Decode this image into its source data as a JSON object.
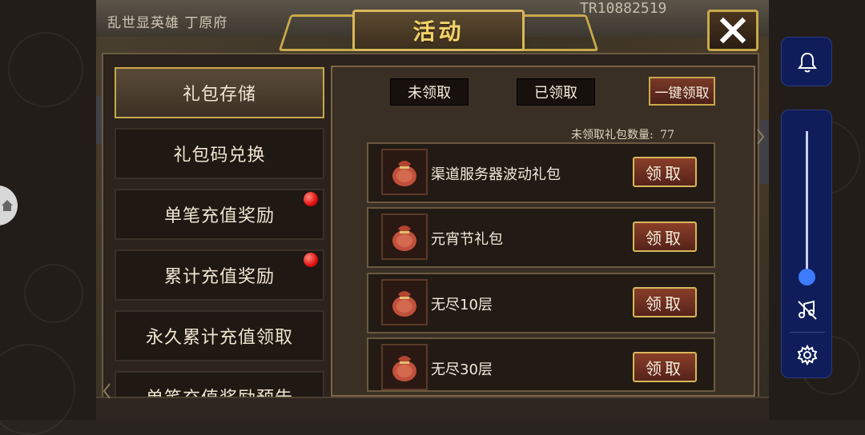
{
  "game": {
    "title": "乱世显英雄 丁原府",
    "player_id": "TR10882519"
  },
  "dialog": {
    "title": "活动"
  },
  "sidebar": {
    "tabs": [
      {
        "label": "礼包存储",
        "active": true,
        "badge": false
      },
      {
        "label": "礼包码兑换",
        "active": false,
        "badge": false
      },
      {
        "label": "单笔充值奖励",
        "active": false,
        "badge": true
      },
      {
        "label": "累计充值奖励",
        "active": false,
        "badge": true
      },
      {
        "label": "永久累计充值领取",
        "active": false,
        "badge": false
      },
      {
        "label": "单笔充值奖励预告",
        "active": false,
        "badge": false
      }
    ]
  },
  "filters": {
    "unclaimed": "未领取",
    "claimed": "已领取",
    "claim_all": "一键领取"
  },
  "count": {
    "label": "未领取礼包数量:",
    "value": "77"
  },
  "gifts": [
    {
      "name": "渠道服务器波动礼包",
      "button": "领取",
      "icon": "gift-bag-icon"
    },
    {
      "name": "元宵节礼包",
      "button": "领取",
      "icon": "gift-bag-icon"
    },
    {
      "name": "无尽10层",
      "button": "领取",
      "icon": "gift-bag-icon"
    },
    {
      "name": "无尽30层",
      "button": "领取",
      "icon": "gift-bag-icon"
    }
  ],
  "colors": {
    "accent_gold": "#c9a84a",
    "badge_red": "#e01010",
    "overlay_blue": "#0f1e5a",
    "slider_blue": "#3d7bff"
  },
  "overlay": {
    "icons": [
      "bell-icon",
      "music-off-icon",
      "gear-icon"
    ],
    "volume_level": 0.0
  }
}
